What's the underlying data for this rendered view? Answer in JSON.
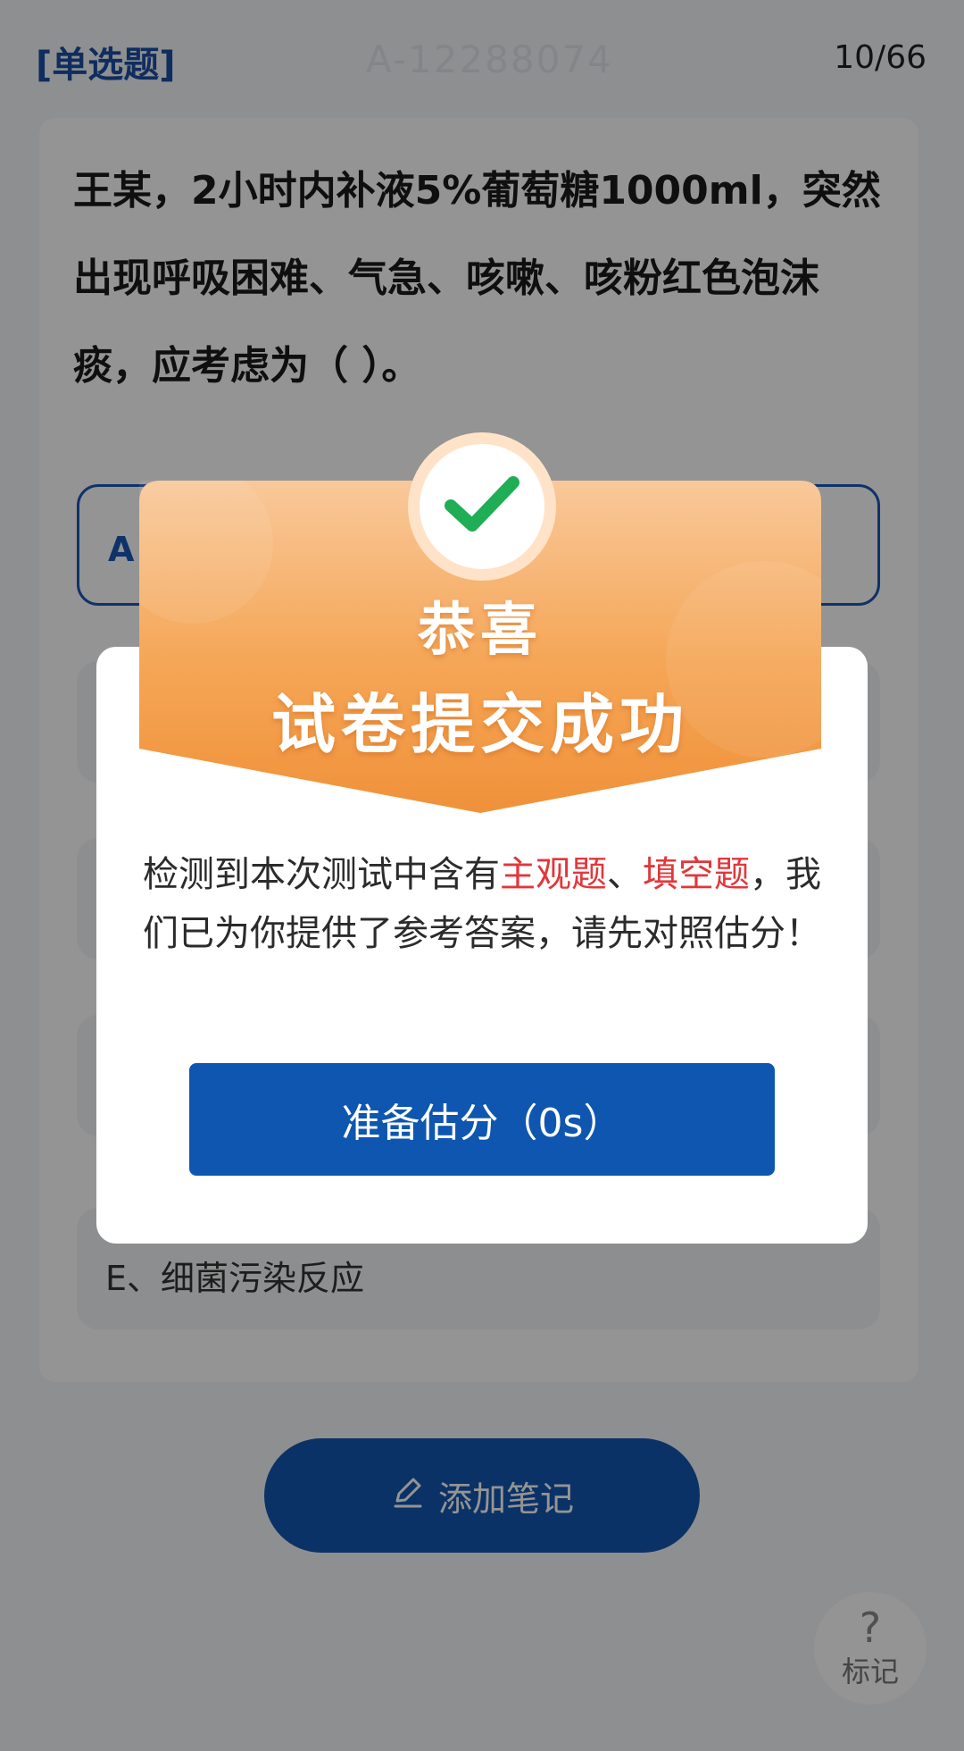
{
  "header": {
    "question_type": "[单选题]",
    "question_id": "A-12288074",
    "progress": "10/66"
  },
  "question": {
    "stem": "王某，2小时内补液5%葡萄糖1000ml，突然出现呼吸困难、气急、咳嗽、咳粉红色泡沫痰，应考虑为（ ）。",
    "options": [
      {
        "label": "A"
      },
      {
        "label": ""
      },
      {
        "label": ""
      },
      {
        "label": ""
      },
      {
        "label": "E、细菌污染反应"
      }
    ]
  },
  "bottom": {
    "note_label": "添加笔记",
    "mark_glyph": "?",
    "mark_label": "标记"
  },
  "dialog": {
    "congrats": "恭喜",
    "title": "试卷提交成功",
    "message_parts": [
      {
        "text": "检测到本次测试中含有",
        "highlight": false
      },
      {
        "text": "主观题",
        "highlight": true
      },
      {
        "text": "、",
        "highlight": false
      },
      {
        "text": "填空题",
        "highlight": true
      },
      {
        "text": "，我们已为你提供了参考答案，请先对照估分！",
        "highlight": false
      }
    ],
    "button_label": "准备估分（0s）"
  },
  "colors": {
    "primary": "#0e56b0",
    "highlight": "#e2373b",
    "banner_orange": "#f5a04a",
    "check_green": "#1fae55"
  },
  "icons": {
    "success": "check-icon",
    "note": "pencil-icon"
  }
}
